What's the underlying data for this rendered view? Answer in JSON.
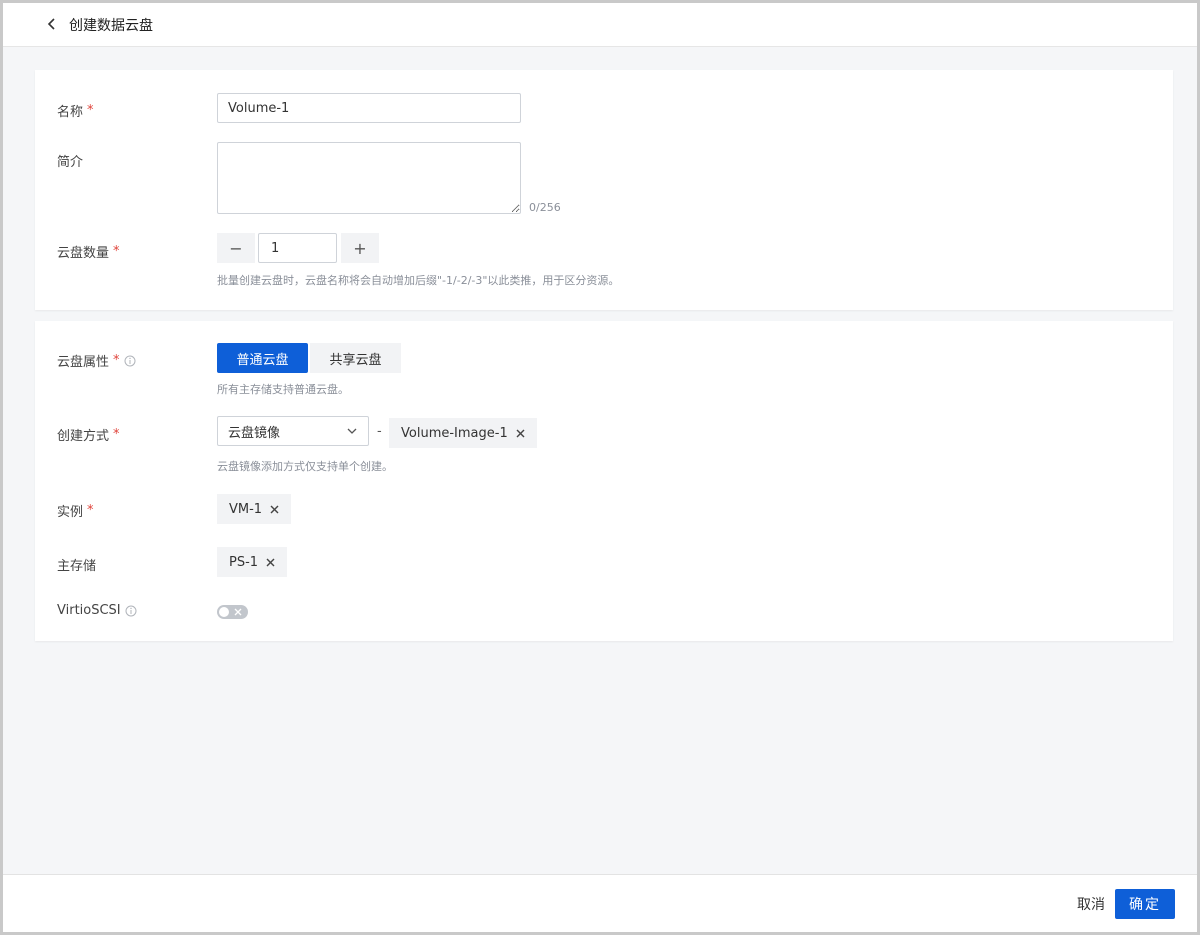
{
  "header": {
    "title": "创建数据云盘"
  },
  "basic": {
    "name_label": "名称",
    "name_value": "Volume-1",
    "desc_label": "简介",
    "desc_value": "",
    "desc_counter": "0/256",
    "count_label": "云盘数量",
    "count_value": "1",
    "count_minus": "−",
    "count_plus": "+",
    "count_hint": "批量创建云盘时，云盘名称将会自动增加后缀\"-1/-2/-3\"以此类推，用于区分资源。"
  },
  "advanced": {
    "attr_label": "云盘属性",
    "attr_options": [
      "普通云盘",
      "共享云盘"
    ],
    "attr_selected": "普通云盘",
    "attr_hint": "所有主存储支持普通云盘。",
    "method_label": "创建方式",
    "method_value": "云盘镜像",
    "method_dash": "-",
    "method_tag": "Volume-Image-1",
    "method_hint": "云盘镜像添加方式仅支持单个创建。",
    "instance_label": "实例",
    "instance_tag": "VM-1",
    "storage_label": "主存储",
    "storage_tag": "PS-1",
    "virtio_label": "VirtioSCSI",
    "virtio_enabled": false
  },
  "footer": {
    "cancel_label": "取消",
    "confirm_label": "确定"
  },
  "colors": {
    "primary": "#0e5fd8",
    "required": "#e0433a"
  }
}
